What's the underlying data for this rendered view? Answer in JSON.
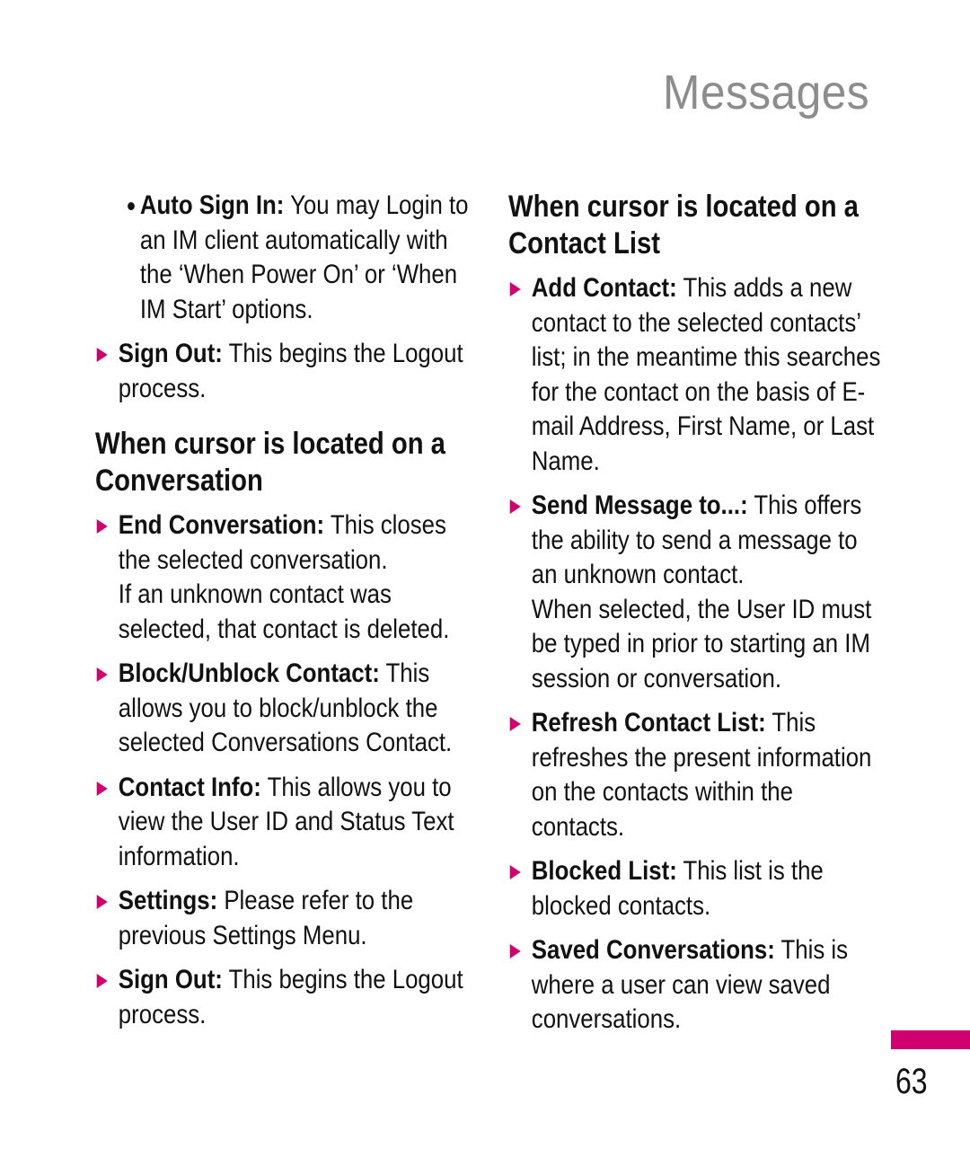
{
  "header": {
    "title": "Messages"
  },
  "left_column": {
    "pre_items": [
      {
        "type": "bullet",
        "term": "Auto Sign In:",
        "text": " You may Login to an IM client automatically with the ‘When Power On’ or ‘When IM Start’ options."
      },
      {
        "type": "arrow",
        "term": "Sign Out:",
        "text": " This begins the Logout process."
      }
    ],
    "section": {
      "heading": "When cursor is located on a Conversation",
      "items": [
        {
          "term": "End Conversation:",
          "text": " This closes the selected conversation.",
          "extra": "If an unknown contact was selected, that contact is deleted."
        },
        {
          "term": "Block/Unblock Contact:",
          "text": " This allows you to block/unblock the selected Conversations Contact."
        },
        {
          "term": "Contact Info:",
          "text": " This allows you to view the User ID and Status Text information."
        },
        {
          "term": "Settings:",
          "text": " Please refer to the previous Settings Menu."
        },
        {
          "term": "Sign Out:",
          "text": " This begins the Logout process."
        }
      ]
    }
  },
  "right_column": {
    "section": {
      "heading": "When cursor is located on a Contact List",
      "items": [
        {
          "term": "Add Contact:",
          "text": " This adds a new contact to the selected contacts’ list; in the meantime this searches for the contact on the basis of E-mail Address, First Name, or Last Name."
        },
        {
          "term": "Send Message to...:",
          "text": " This offers the ability to send a message to an unknown contact.",
          "extra": "When selected, the User ID must be typed in prior to starting an IM session or conversation."
        },
        {
          "term": "Refresh Contact List:",
          "text": " This refreshes the present information on the contacts within the contacts."
        },
        {
          "term": "Blocked List:",
          "text": " This list is the blocked contacts."
        },
        {
          "term": "Saved Conversations:",
          "text": " This is where a user can view saved conversations."
        }
      ]
    }
  },
  "footer": {
    "page_number": "63",
    "accent_color": "#d0006f"
  }
}
